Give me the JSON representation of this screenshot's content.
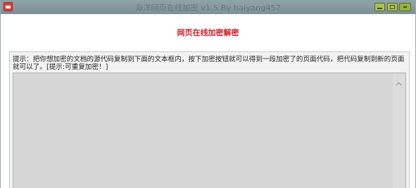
{
  "window": {
    "title": "海洋网页在线加密 v1.5 By haiyang457",
    "controls": {
      "minimize": "minimize-button",
      "maximize": "maximize-button",
      "close": "close-button"
    }
  },
  "main": {
    "heading": "网页在线加密解密",
    "tip": "提示：把你想加密的文档的源代码复制到下面的文本框内，按下加密按钮就可以得到一段加密了的页面代码，把代码复制到新的页面就可以了。[提示:可重复加密！]",
    "editor_value": ""
  },
  "colors": {
    "titlebar": "#8fa3a8",
    "heading": "#d21f2c",
    "editor_bg": "#d6d6d6"
  },
  "icons": {
    "app": "app-icon",
    "scroll_up": "chevron-up-icon"
  }
}
